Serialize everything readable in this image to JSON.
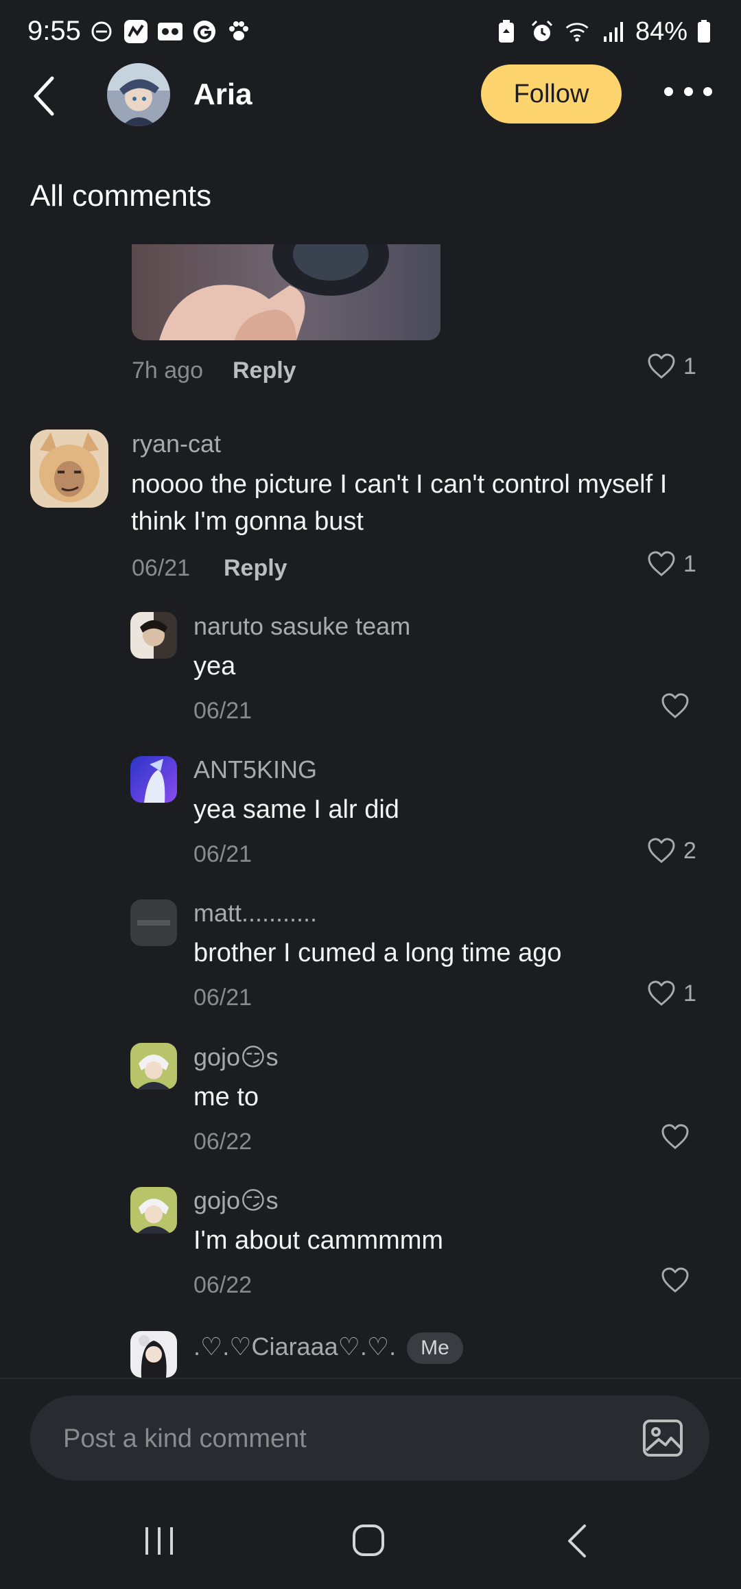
{
  "status": {
    "time": "9:55",
    "battery": "84%",
    "left_icons": [
      "dnd-icon",
      "app-icon",
      "voicemail-icon",
      "g-icon",
      "paw-icon"
    ],
    "right_icons": [
      "battery-saver-icon",
      "alarm-icon",
      "wifi-icon",
      "signal-icon",
      "battery-icon"
    ]
  },
  "header": {
    "name": "Aria",
    "follow_label": "Follow"
  },
  "section_title": "All comments",
  "top_comment": {
    "time": "7h ago",
    "reply_label": "Reply",
    "likes": "1"
  },
  "comments": [
    {
      "username": "ryan-cat",
      "text": "noooo the picture I can't I can't control myself I think I'm gonna bust",
      "date": "06/21",
      "reply_label": "Reply",
      "likes": "1"
    }
  ],
  "replies": [
    {
      "username": "naruto sasuke team",
      "text": "yea",
      "date": "06/21",
      "likes": ""
    },
    {
      "username": "ANT5KING",
      "text": "yea same I alr did",
      "date": "06/21",
      "likes": "2"
    },
    {
      "username": "matt...........",
      "text": "brother I cumed a long time ago",
      "date": "06/21",
      "likes": "1"
    },
    {
      "username": "gojo😏s",
      "text": "me to",
      "date": "06/22",
      "likes": ""
    },
    {
      "username": "gojo😏s",
      "text": "I'm about cammmmm",
      "date": "06/22",
      "likes": ""
    },
    {
      "username": ".♡.♡Ciaraaa♡.♡.",
      "badge": "Me"
    }
  ],
  "composer": {
    "placeholder": "Post a kind comment"
  },
  "colors": {
    "background": "#1c1d21",
    "follow": "#fed46e",
    "muted": "#8a8b8f"
  }
}
